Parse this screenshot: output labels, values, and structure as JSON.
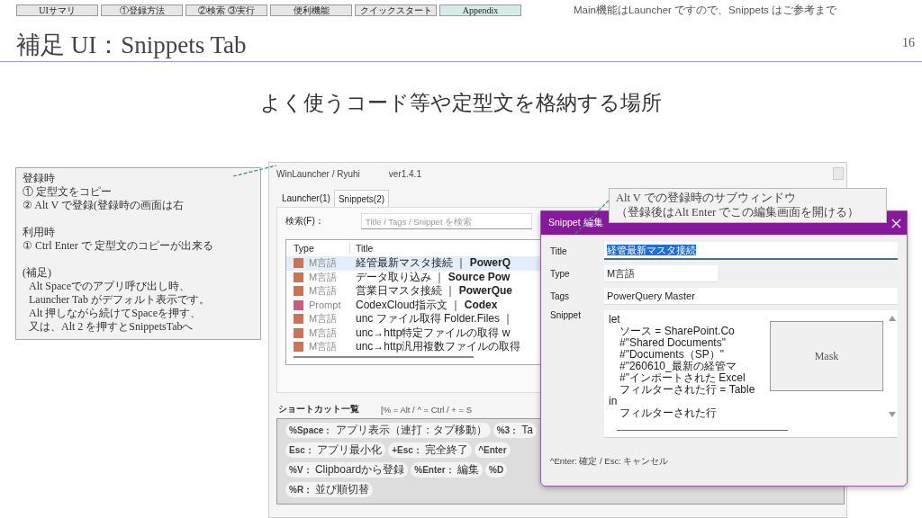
{
  "nav": {
    "tabs": [
      {
        "label": "UIサマリ",
        "selected": false
      },
      {
        "label": "①登録方法",
        "selected": false
      },
      {
        "label": "②検索 ③実行",
        "selected": false
      },
      {
        "label": "便利機能",
        "selected": false
      },
      {
        "label": "クイックスタート",
        "selected": false
      },
      {
        "label": "Appendix",
        "selected": true
      }
    ],
    "note": "Main機能はLauncher ですので、Snippets はご参考まで"
  },
  "slide": {
    "title": "補足 UI：Snippets Tab",
    "page_number": "16",
    "subtitle": "よく使うコード等や定型文を格納する場所"
  },
  "note_box": {
    "sections": [
      {
        "heading": "登録時",
        "lines": [
          "① 定型文をコピー",
          "② Alt V で登録(登録時の画面は右"
        ]
      },
      {
        "heading": "利用時",
        "lines": [
          "① Ctrl Enter  で  定型文のコピーが出来る"
        ]
      },
      {
        "heading": "(補足)",
        "lines": [
          "Alt Spaceでのアプリ呼び出し時、",
          "Launcher Tab がデフォルト表示です。",
          "Alt 押しながら続けてSpaceを押す、",
          "又は、Alt 2 を押すとSnippetsTabへ"
        ]
      }
    ]
  },
  "callout": {
    "lines": [
      "Alt V での登録時のサブウィンドウ",
      "（登録後はAlt Enter でこの編集画面を開ける）"
    ]
  },
  "app_window": {
    "title": "WinLauncher / Ryuhi",
    "version": "ver1.4.1",
    "tabs": [
      {
        "label": "Launcher(1)",
        "selected": false
      },
      {
        "label": "Snippets(2)",
        "selected": true
      }
    ],
    "search": {
      "label": "検索(F)：",
      "placeholder": "Title / Tags / Snippet を検索"
    },
    "table": {
      "columns": [
        "Type",
        "Title"
      ],
      "rows": [
        {
          "type": "M言語",
          "color": "#c87456",
          "title": "経管最新マスタ接続 ｜ **PowerQ**",
          "selected": true
        },
        {
          "type": "M言語",
          "color": "#c87456",
          "title": "データ取り込み ｜ **Source Pow**",
          "selected": false
        },
        {
          "type": "M言語",
          "color": "#c87456",
          "title": "営業日マスタ接続 ｜ **PowerQue**",
          "selected": false
        },
        {
          "type": "Prompt",
          "color": "#c0607e",
          "title": "CodexCloud指示文 ｜ **Codex**",
          "selected": false
        },
        {
          "type": "M言語",
          "color": "#c87456",
          "title": "unc ファイル取得 Folder.Files ｜",
          "selected": false
        },
        {
          "type": "M言語",
          "color": "#c87456",
          "title": "unc→http特定ファイルの取得 w",
          "selected": false
        },
        {
          "type": "M言語",
          "color": "#c87456",
          "title": "unc→http汎用複数ファイルの取得",
          "selected": false
        }
      ]
    },
    "shortcuts": {
      "title": "ショートカット一覧",
      "legend": "[% = Alt / ^ = Ctrl / + = S",
      "lines": [
        {
          "chips": [
            {
              "key": "%Space：",
              "desc": "アプリ表示（連打：タブ移動）"
            },
            {
              "key": "%3：",
              "desc": "Ta"
            }
          ]
        },
        {
          "chips": [
            {
              "key": "Esc：",
              "desc": "アプリ最小化"
            },
            {
              "key": "+Esc：",
              "desc": "完全終了"
            },
            {
              "key": "^Enter"
            }
          ]
        },
        {
          "chips": [
            {
              "key": "%V：",
              "desc": "Clipboardから登録"
            },
            {
              "key": "%Enter：",
              "desc": "編集"
            },
            {
              "key": "%D"
            }
          ]
        },
        {
          "chips": [
            {
              "key": "%R：",
              "desc": "並び順切替"
            }
          ]
        }
      ]
    }
  },
  "dialog": {
    "title": "Snippet 編集",
    "fields": [
      {
        "label": "Title",
        "value": "経管最新マスタ接続",
        "text_selected": true
      },
      {
        "label": "Type",
        "value": "M言語",
        "text_selected": false
      },
      {
        "label": "Tags",
        "value": "PowerQuery Master",
        "text_selected": false
      }
    ],
    "snippet_label": "Snippet",
    "code": [
      {
        "kind": "keyword",
        "text": "let"
      },
      {
        "kind": "step",
        "text": "ソース = SharePoint.Co"
      },
      {
        "kind": "step",
        "text": "#\"Shared Documents\""
      },
      {
        "kind": "step",
        "text": "#\"Documents（SP）\""
      },
      {
        "kind": "step",
        "text": "#\"260610_最新の経管マ"
      },
      {
        "kind": "step",
        "text": "#\"インポートされた Excel"
      },
      {
        "kind": "step",
        "text": "フィルターされた行 = Table"
      },
      {
        "kind": "keyword",
        "text": "in"
      },
      {
        "kind": "step",
        "text": "フィルターされた行"
      }
    ],
    "mask": "Mask",
    "footer": "^Enter: 確定 / Esc: キャンセル"
  }
}
